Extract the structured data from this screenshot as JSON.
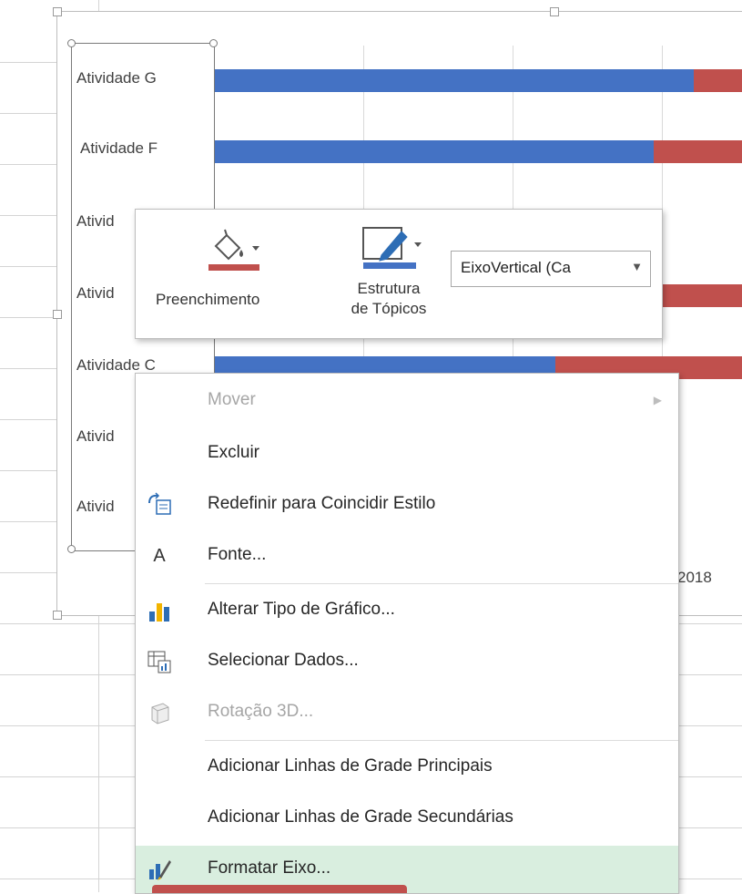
{
  "chart": {
    "categories": [
      "Atividade G",
      "Atividade F",
      "Ativid",
      "Ativid",
      "Atividade C",
      "Ativid",
      "Ativid"
    ],
    "x_tick_label": "2018",
    "series_colors": {
      "blue": "#4472c4",
      "red": "#c0504d"
    }
  },
  "chart_data": {
    "type": "bar",
    "categories": [
      "Atividade G",
      "Atividade F",
      "Ativid",
      "Ativid",
      "Atividade C",
      "Ativid",
      "Ativid"
    ],
    "series": [
      {
        "values": [
          0.73,
          0.67,
          null,
          null,
          0.52,
          null,
          null
        ]
      },
      {
        "values": [
          0.22,
          0.17,
          null,
          null,
          0.33,
          null,
          null
        ]
      }
    ],
    "xlabel": "",
    "ylabel": "",
    "x_tick_labels": [
      "2018"
    ]
  },
  "mini_toolbar": {
    "fill_label": "Preenchimento",
    "fill_icon": "paint-bucket-icon",
    "outline_label_line1": "Estrutura",
    "outline_label_line2": "de Tópicos",
    "outline_icon": "pen-icon",
    "element_selector_value": "EixoVertical (Ca"
  },
  "context_menu": {
    "items": [
      {
        "label": "Mover",
        "icon": "",
        "disabled": true,
        "submenu": true
      },
      {
        "label": "Excluir",
        "icon": ""
      },
      {
        "label": "Redefinir para Coincidir Estilo",
        "icon": "reset-style-icon"
      },
      {
        "label": "Fonte...",
        "icon": "font-icon"
      },
      {
        "label": "Alterar Tipo de Gráfico...",
        "icon": "chart-type-icon"
      },
      {
        "label": "Selecionar Dados...",
        "icon": "select-data-icon"
      },
      {
        "label": "Rotação 3D...",
        "icon": "3d-rotation-icon",
        "disabled": true
      },
      {
        "label": "Adicionar Linhas de Grade Principais",
        "icon": ""
      },
      {
        "label": "Adicionar Linhas de Grade Secundárias",
        "icon": ""
      },
      {
        "label": "Formatar Eixo...",
        "icon": "format-axis-icon",
        "highlighted": true
      }
    ]
  }
}
